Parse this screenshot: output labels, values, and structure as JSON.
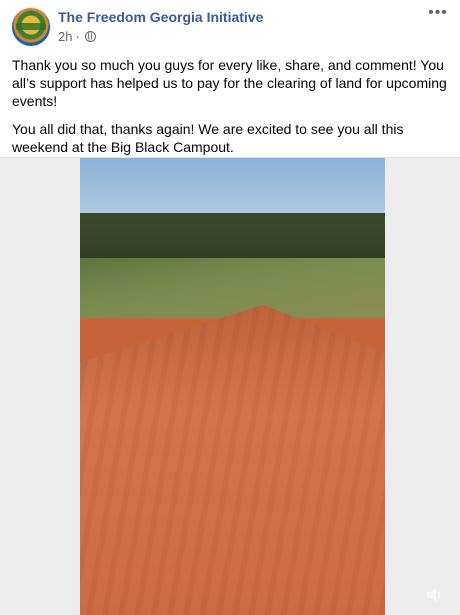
{
  "post": {
    "page_name": "The Freedom Georgia Initiative",
    "time": "2h",
    "separator": "·",
    "paragraphs": [
      "Thank you so much you guys for every like, share, and comment! You all’s support has helped us to pay for the clearing of land for upcoming events!",
      "You all did that, thanks again! We are excited to see you all this weekend at the Big Black Campout."
    ]
  },
  "icons": {
    "privacy": "globe-icon",
    "menu": "more-options-icon",
    "audio": "speaker-icon"
  },
  "colors": {
    "page_name": "#3b5998",
    "meta": "#65676b"
  }
}
